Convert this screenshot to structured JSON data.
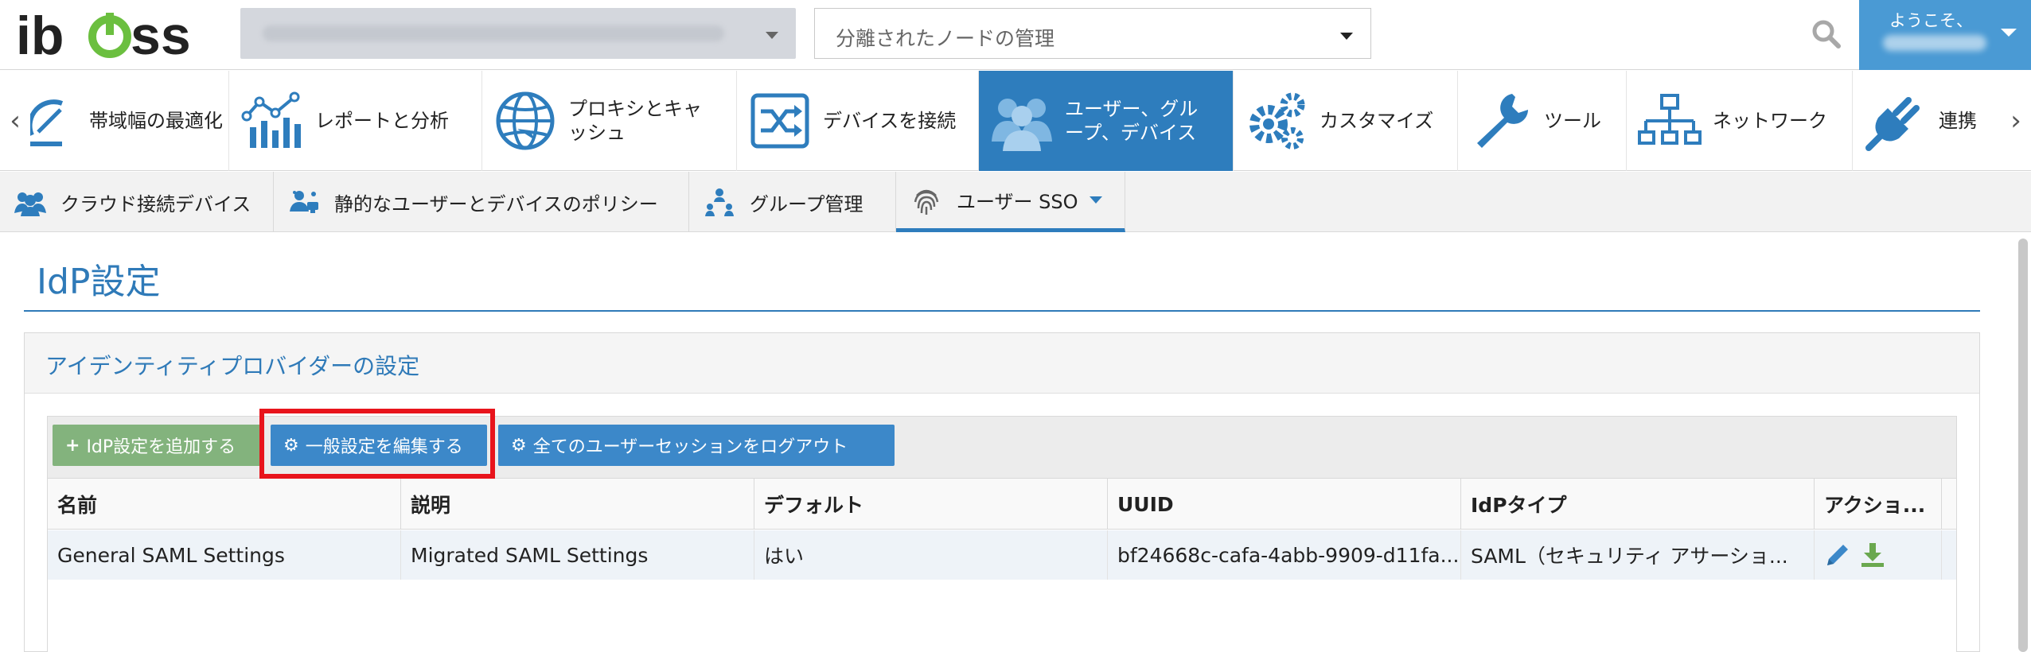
{
  "header": {
    "logo_text": "iboss",
    "node_select_value": "",
    "isolated_nodes_label": "分離されたノードの管理",
    "welcome_text": "ようこそ、",
    "search_icon": "search-icon"
  },
  "main_nav": {
    "items": [
      {
        "label": "帯域幅の最適化",
        "icon": "speedometer-icon"
      },
      {
        "label": "レポートと分析",
        "icon": "analytics-chart-icon"
      },
      {
        "label_line1": "プロキシとキャ",
        "label_line2": "ッシュ",
        "icon": "globe-proxy-icon"
      },
      {
        "label": "デバイスを接続",
        "icon": "shuffle-connect-icon"
      },
      {
        "label_line1": "ユーザー、グル",
        "label_line2": "ープ、デバイス",
        "icon": "users-icon",
        "active": true
      },
      {
        "label": "カスタマイズ",
        "icon": "gears-icon"
      },
      {
        "label": "ツール",
        "icon": "wrench-icon"
      },
      {
        "label": "ネットワーク",
        "icon": "network-tree-icon"
      },
      {
        "label": "連携",
        "icon": "plug-icon"
      }
    ]
  },
  "sub_nav": {
    "items": [
      {
        "label": "クラウド接続デバイス",
        "icon": "users-group-icon"
      },
      {
        "label": "静的なユーザーとデバイスのポリシー",
        "icon": "user-policy-icon"
      },
      {
        "label": "グループ管理",
        "icon": "group-sitemap-icon"
      },
      {
        "label": "ユーザー SSO",
        "icon": "fingerprint-icon",
        "active": true
      }
    ]
  },
  "page": {
    "title": "IdP設定",
    "panel_title": "アイデンティティプロバイダーの設定"
  },
  "toolbar": {
    "add_label": "IdP設定を追加する",
    "edit_general_label": "一般設定を編集する",
    "logout_all_label": "全てのユーザーセッションをログアウト"
  },
  "table": {
    "columns": [
      "名前",
      "説明",
      "デフォルト",
      "UUID",
      "IdPタイプ",
      "アクショ..."
    ],
    "rows": [
      {
        "name": "General SAML Settings",
        "description": "Migrated SAML Settings",
        "default": "はい",
        "uuid": "bf24668c-cafa-4abb-9909-d11fa...",
        "idp_type": "SAML（セキュリティ アサーショ...",
        "actions": [
          "pencil-edit-icon",
          "download-icon"
        ]
      }
    ]
  },
  "colors": {
    "brand_blue": "#2e7dbd",
    "title_blue": "#2f7ab8",
    "button_blue": "#3c88c9",
    "button_green": "#83b37d",
    "highlight_red": "#e8141c",
    "logo_green": "#6bbf3f"
  }
}
